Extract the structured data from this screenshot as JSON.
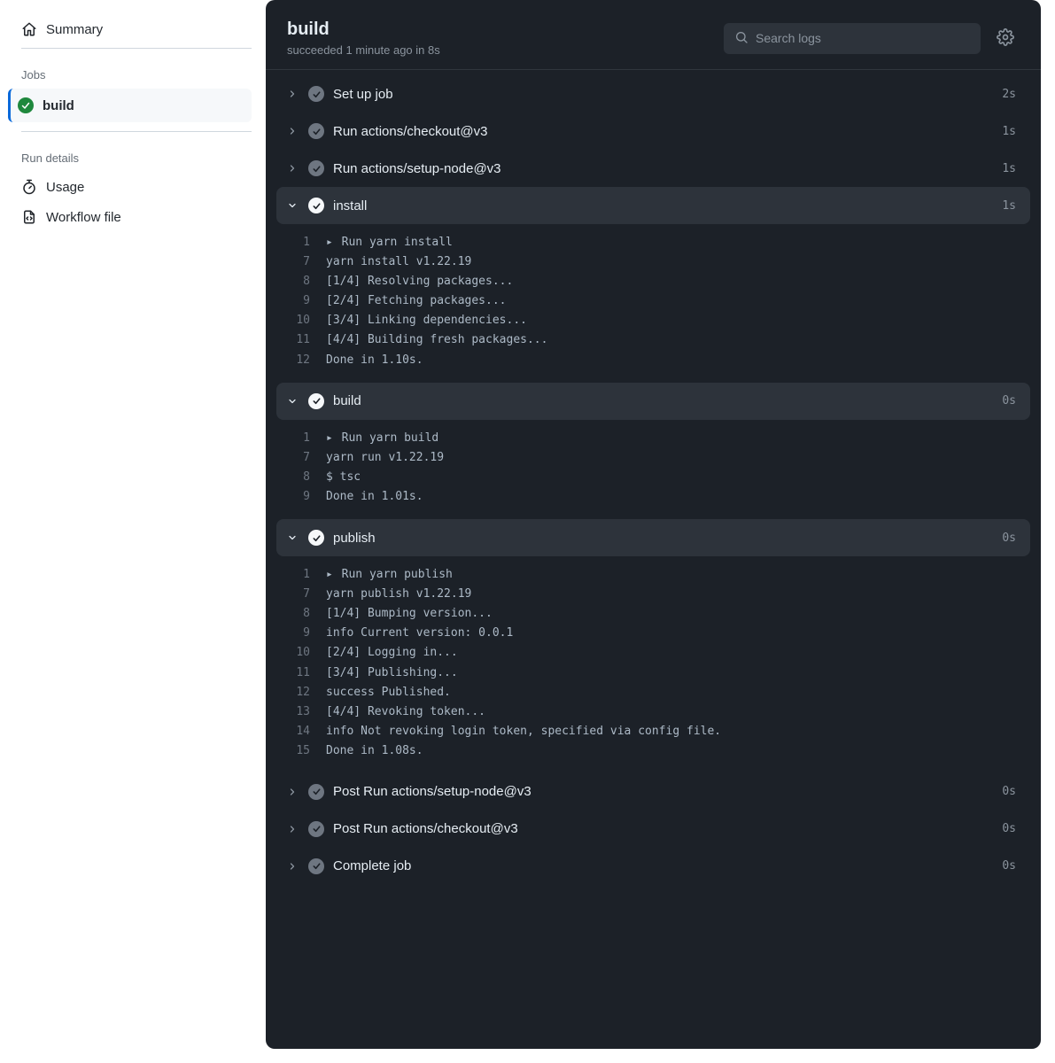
{
  "sidebar": {
    "summary_label": "Summary",
    "jobs_label": "Jobs",
    "job_name": "build",
    "run_details_label": "Run details",
    "usage_label": "Usage",
    "workflow_file_label": "Workflow file"
  },
  "header": {
    "title": "build",
    "status_line": "succeeded 1 minute ago in 8s",
    "search_placeholder": "Search logs"
  },
  "steps": [
    {
      "name": "Set up job",
      "time": "2s",
      "expanded": false,
      "lines": []
    },
    {
      "name": "Run actions/checkout@v3",
      "time": "1s",
      "expanded": false,
      "lines": []
    },
    {
      "name": "Run actions/setup-node@v3",
      "time": "1s",
      "expanded": false,
      "lines": []
    },
    {
      "name": "install",
      "time": "1s",
      "expanded": true,
      "lines": [
        {
          "n": 1,
          "caret": true,
          "t": "Run yarn install"
        },
        {
          "n": 7,
          "t": "yarn install v1.22.19"
        },
        {
          "n": 8,
          "t": "[1/4] Resolving packages..."
        },
        {
          "n": 9,
          "t": "[2/4] Fetching packages..."
        },
        {
          "n": 10,
          "t": "[3/4] Linking dependencies..."
        },
        {
          "n": 11,
          "t": "[4/4] Building fresh packages..."
        },
        {
          "n": 12,
          "t": "Done in 1.10s."
        }
      ]
    },
    {
      "name": "build",
      "time": "0s",
      "expanded": true,
      "lines": [
        {
          "n": 1,
          "caret": true,
          "t": "Run yarn build"
        },
        {
          "n": 7,
          "t": "yarn run v1.22.19"
        },
        {
          "n": 8,
          "t": "$ tsc"
        },
        {
          "n": 9,
          "t": "Done in 1.01s."
        }
      ]
    },
    {
      "name": "publish",
      "time": "0s",
      "expanded": true,
      "lines": [
        {
          "n": 1,
          "caret": true,
          "t": "Run yarn publish"
        },
        {
          "n": 7,
          "t": "yarn publish v1.22.19"
        },
        {
          "n": 8,
          "t": "[1/4] Bumping version..."
        },
        {
          "n": 9,
          "t": "info Current version: 0.0.1"
        },
        {
          "n": 10,
          "t": "[2/4] Logging in..."
        },
        {
          "n": 11,
          "t": "[3/4] Publishing..."
        },
        {
          "n": 12,
          "t": "success Published."
        },
        {
          "n": 13,
          "t": "[4/4] Revoking token..."
        },
        {
          "n": 14,
          "t": "info Not revoking login token, specified via config file."
        },
        {
          "n": 15,
          "t": "Done in 1.08s."
        }
      ]
    },
    {
      "name": "Post Run actions/setup-node@v3",
      "time": "0s",
      "expanded": false,
      "lines": []
    },
    {
      "name": "Post Run actions/checkout@v3",
      "time": "0s",
      "expanded": false,
      "lines": []
    },
    {
      "name": "Complete job",
      "time": "0s",
      "expanded": false,
      "lines": []
    }
  ]
}
